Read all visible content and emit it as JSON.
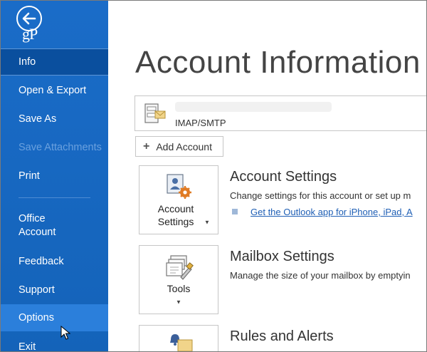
{
  "sidebar": {
    "logo": "gP",
    "items": [
      {
        "label": "Info",
        "state": "selected"
      },
      {
        "label": "Open & Export",
        "state": "normal"
      },
      {
        "label": "Save As",
        "state": "normal"
      },
      {
        "label": "Save Attachments",
        "state": "disabled"
      },
      {
        "label": "Print",
        "state": "normal"
      },
      {
        "label": "Office\nAccount",
        "state": "normal"
      },
      {
        "label": "Feedback",
        "state": "normal"
      },
      {
        "label": "Support",
        "state": "normal"
      },
      {
        "label": "Options",
        "state": "hover"
      },
      {
        "label": "Exit",
        "state": "normal"
      }
    ]
  },
  "main": {
    "title": "Account Information",
    "account": {
      "type": "IMAP/SMTP"
    },
    "add_account_label": "Add Account",
    "sections": [
      {
        "tile_label": "Account Settings",
        "title": "Account Settings",
        "desc": "Change settings for this account or set up m",
        "link": "Get the Outlook app for iPhone, iPad, A"
      },
      {
        "tile_label": "Tools",
        "title": "Mailbox Settings",
        "desc": "Manage the size of your mailbox by emptyin"
      },
      {
        "title": "Rules and Alerts"
      }
    ]
  },
  "colors": {
    "sidebar_bg": "#1565c0",
    "selected_bg": "#0a4f9e",
    "hover_bg": "#2b7fdb",
    "link": "#1f5fb5"
  }
}
